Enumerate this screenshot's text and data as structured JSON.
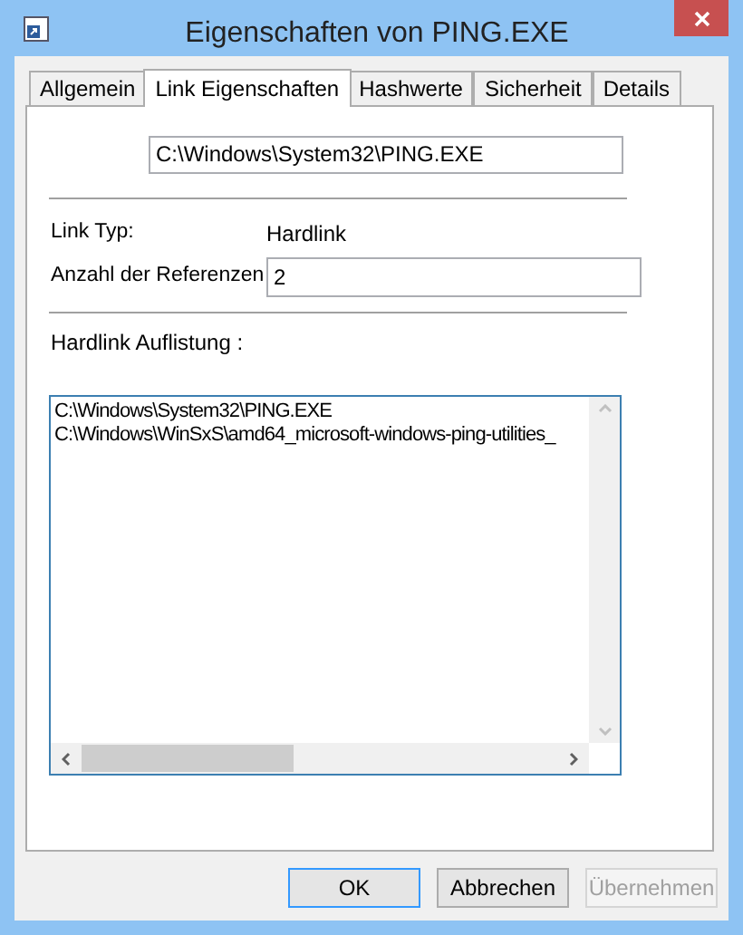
{
  "window": {
    "title": "Eigenschaften von PING.EXE"
  },
  "tabs": [
    {
      "label": "Allgemein",
      "selected": false
    },
    {
      "label": "Link Eigenschaften",
      "selected": true
    },
    {
      "label": "Hashwerte",
      "selected": false
    },
    {
      "label": "Sicherheit",
      "selected": false
    },
    {
      "label": "Details",
      "selected": false
    }
  ],
  "path_field": {
    "value": "C:\\Windows\\System32\\PING.EXE"
  },
  "fields": [
    {
      "label": "Link Typ:",
      "value": "Hardlink",
      "kind": "text"
    },
    {
      "label": "Anzahl der Referenzen",
      "value": "2",
      "kind": "input"
    }
  ],
  "hardlink_list": {
    "label": "Hardlink Auflistung :",
    "items": [
      "C:\\Windows\\System32\\PING.EXE",
      "C:\\Windows\\WinSxS\\amd64_microsoft-windows-ping-utilities_"
    ]
  },
  "buttons": [
    {
      "label": "OK",
      "default": true,
      "disabled": false
    },
    {
      "label": "Abbrechen",
      "default": false,
      "disabled": false
    },
    {
      "label": "Übernehmen",
      "default": false,
      "disabled": true
    }
  ]
}
